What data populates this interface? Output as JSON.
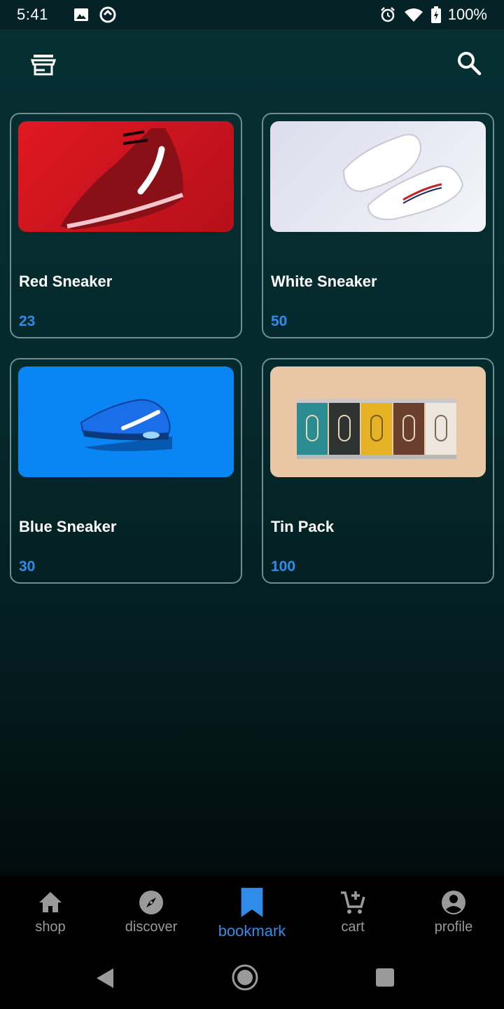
{
  "status": {
    "time": "5:41",
    "battery": "100%",
    "icons": [
      "image-icon",
      "sync-icon",
      "alarm-icon",
      "wifi-icon",
      "battery-icon"
    ]
  },
  "appbar": {
    "left_icon": "store-icon",
    "right_icon": "search-icon"
  },
  "products": [
    {
      "name": "Red Sneaker",
      "price": "23",
      "image": "red-sneaker-photo"
    },
    {
      "name": "White Sneaker",
      "price": "50",
      "image": "white-sneaker-photo"
    },
    {
      "name": "Blue Sneaker",
      "price": "30",
      "image": "blue-sneaker-photo"
    },
    {
      "name": "Tin Pack",
      "price": "100",
      "image": "tin-pack-photo"
    }
  ],
  "nav": {
    "items": [
      {
        "label": "shop",
        "icon": "home-icon"
      },
      {
        "label": "discover",
        "icon": "compass-icon"
      },
      {
        "label": "bookmark",
        "icon": "bookmark-icon",
        "active": true
      },
      {
        "label": "cart",
        "icon": "cart-add-icon"
      },
      {
        "label": "profile",
        "icon": "profile-icon"
      }
    ]
  },
  "colors": {
    "accent": "#2f8ce8",
    "background": "#063033",
    "card_border": "#6f8e92",
    "inactive": "#9a9a9a"
  }
}
